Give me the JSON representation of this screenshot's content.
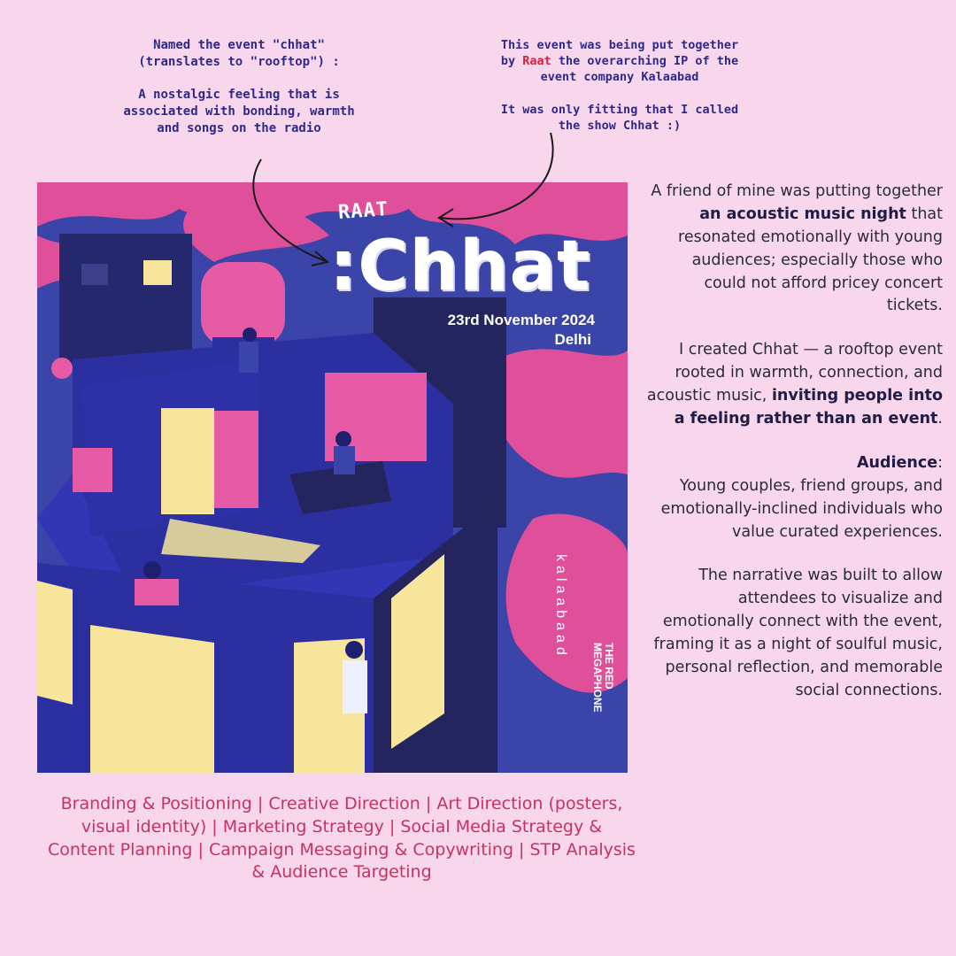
{
  "annotations": {
    "left": {
      "line1": "Named the event \"chhat\"",
      "line2": "(translates to \"rooftop\") :",
      "line3": "A nostalgic feeling that is",
      "line4": "associated with bonding, warmth",
      "line5": "and songs on the radio"
    },
    "right": {
      "line1": "This event was being put together",
      "line2_prefix": "by ",
      "line2_highlight": "Raat",
      "line2_suffix": " the overarching IP of the",
      "line3": "event company Kalaabad",
      "line4": "It was only fitting that I called",
      "line5": "the show Chhat :)"
    }
  },
  "poster": {
    "brand": "RAAT",
    "title": ":Chhat",
    "date": "23rd November 2024",
    "city": "Delhi",
    "vertical_brand": "kalaabaad",
    "sponsor_line1": "THE RED",
    "sponsor_line2": "MEGAPHONE",
    "colors": {
      "sky": "#3b44a8",
      "clouds": "#e0509a",
      "building": "#2b2fa0",
      "building_dark": "#1e1f6e",
      "window_light": "#f6e59a",
      "accent_pink": "#e75aa6"
    }
  },
  "description": {
    "p1_a": "A friend of mine was putting together ",
    "p1_bold": "an acoustic music night",
    "p1_b": " that resonated emotionally with young audiences; especially those who could not afford pricey concert tickets.",
    "p2_a": "I created Chhat — a rooftop event rooted in warmth, connection, and acoustic music, ",
    "p2_bold": "inviting people into a feeling rather than an event",
    "p2_b": ".",
    "audience_label": "Audience",
    "audience_colon": ":",
    "audience_text": "Young couples, friend groups, and emotionally-inclined individuals who value curated experiences.",
    "p4": "The narrative was built to allow attendees to visualize and emotionally connect with the event, framing it as a night of soulful music, personal reflection, and memorable social connections."
  },
  "skills": "Branding & Positioning | Creative Direction | Art Direction (posters, visual identity) | Marketing Strategy | Social Media Strategy & Content Planning | Campaign Messaging & Copywriting | STP Analysis & Audience Targeting",
  "colors": {
    "background": "#f8d6ec",
    "annotation": "#2e2a8c",
    "highlight": "#d2233f",
    "skills": "#c8325e"
  }
}
